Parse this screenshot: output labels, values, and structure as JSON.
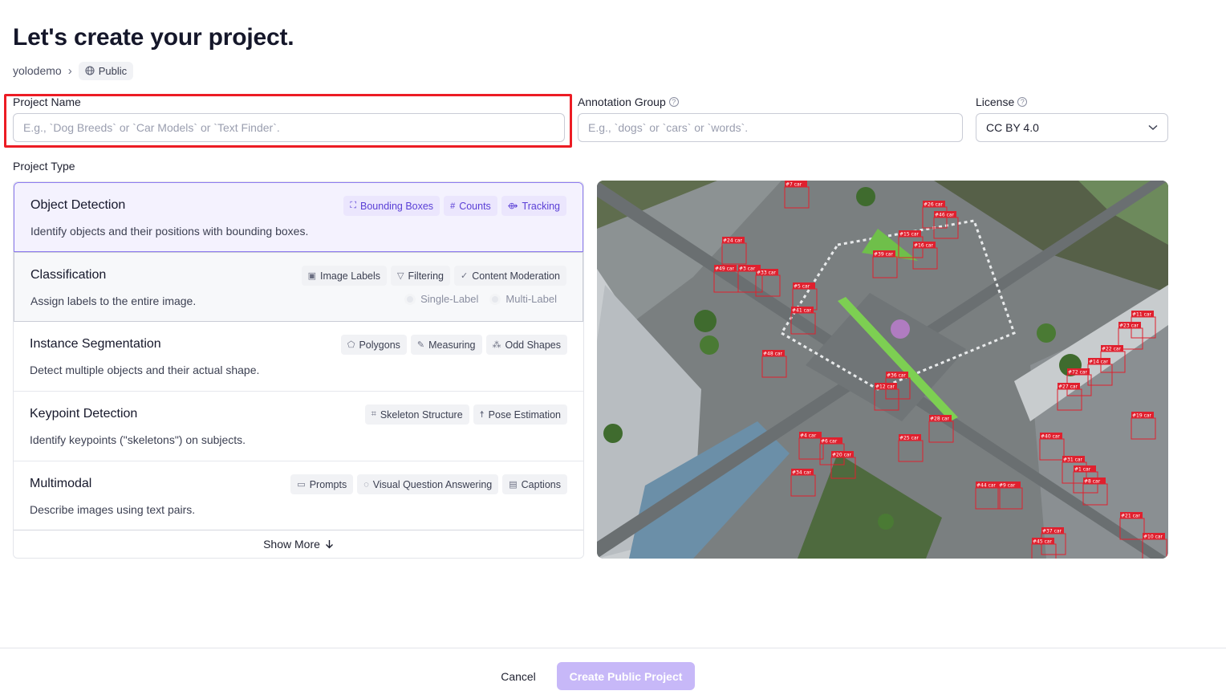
{
  "page": {
    "title": "Let's create your project."
  },
  "breadcrumb": {
    "workspace": "yolodemo",
    "separator": "›",
    "visibility": "Public"
  },
  "form": {
    "project_name": {
      "label": "Project Name",
      "value": "",
      "placeholder": "E.g., `Dog Breeds` or `Car Models` or `Text Finder`."
    },
    "annotation_group": {
      "label": "Annotation Group",
      "value": "",
      "placeholder": "E.g., `dogs` or `cars` or `words`."
    },
    "license": {
      "label": "License",
      "value": "CC BY 4.0"
    }
  },
  "project_type": {
    "label": "Project Type",
    "selected": "Object Detection",
    "types": [
      {
        "name": "Object Detection",
        "description": "Identify objects and their positions with bounding boxes.",
        "tags": [
          "Bounding Boxes",
          "Counts",
          "Tracking"
        ]
      },
      {
        "name": "Classification",
        "description": "Assign labels to the entire image.",
        "tags": [
          "Image Labels",
          "Filtering",
          "Content Moderation"
        ],
        "options": [
          "Single-Label",
          "Multi-Label"
        ]
      },
      {
        "name": "Instance Segmentation",
        "description": "Detect multiple objects and their actual shape.",
        "tags": [
          "Polygons",
          "Measuring",
          "Odd Shapes"
        ]
      },
      {
        "name": "Keypoint Detection",
        "description": "Identify keypoints (\"skeletons\") on subjects.",
        "tags": [
          "Skeleton Structure",
          "Pose Estimation"
        ]
      },
      {
        "name": "Multimodal",
        "description": "Describe images using text pairs.",
        "tags": [
          "Prompts",
          "Visual Question Answering",
          "Captions"
        ]
      }
    ],
    "show_more": "Show More"
  },
  "preview": {
    "labels": [
      "#7 car",
      "#26 car",
      "#46 car",
      "#24 car",
      "#15 car",
      "#16 car",
      "#39 car",
      "#49 car",
      "#3 car",
      "#33 car",
      "#5 car",
      "#41 car",
      "#48 car",
      "#36 car",
      "#12 car",
      "#28 car",
      "#25 car",
      "#4 car",
      "#6 car",
      "#20 car",
      "#34 car",
      "#44 car",
      "#9 car",
      "#11 car",
      "#23 car",
      "#22 car",
      "#14 car",
      "#72 car",
      "#27 car",
      "#19 car",
      "#40 car",
      "#31 car",
      "#1 car",
      "#8 car",
      "#21 car",
      "#37 car",
      "#45 car",
      "#10 car"
    ]
  },
  "footer": {
    "cancel": "Cancel",
    "create": "Create Public Project"
  },
  "colors": {
    "accent": "#7c5cf0",
    "highlight": "#ec1c24",
    "create_button": "#c7b8f8",
    "detection_box": "#e0202e"
  }
}
